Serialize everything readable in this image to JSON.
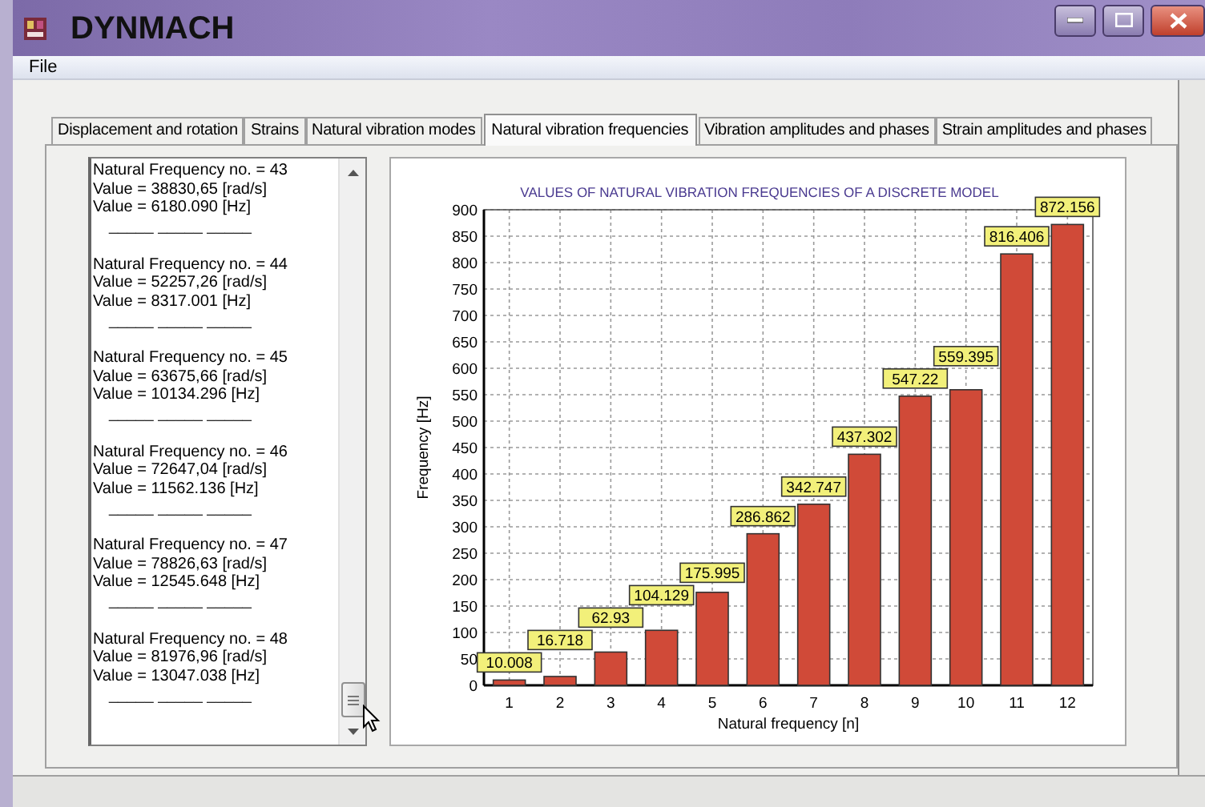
{
  "window": {
    "title": "DYNMACH"
  },
  "menu": [
    "File"
  ],
  "tabs": [
    {
      "label": "Displacement and rotation",
      "selected": false
    },
    {
      "label": "Strains",
      "selected": false
    },
    {
      "label": "Natural vibration modes",
      "selected": false
    },
    {
      "label": "Natural vibration frequencies",
      "selected": true
    },
    {
      "label": "Vibration amplitudes and phases",
      "selected": false
    },
    {
      "label": "Strain amplitudes and phases",
      "selected": false
    }
  ],
  "frequency_list": {
    "entries": [
      {
        "title": "Natural Frequency no. = 43",
        "rad": "Value = 38830,65 [rad/s]",
        "hz": "Value = 6180.090 [Hz]",
        "separator": "_____  _____  _____"
      },
      {
        "title": "Natural Frequency no. = 44",
        "rad": "Value = 52257,26 [rad/s]",
        "hz": "Value = 8317.001 [Hz]",
        "separator": "_____  _____  _____"
      },
      {
        "title": "Natural Frequency no. = 45",
        "rad": "Value = 63675,66 [rad/s]",
        "hz": "Value = 10134.296 [Hz]",
        "separator": "_____  _____  _____"
      },
      {
        "title": "Natural Frequency no. = 46",
        "rad": "Value = 72647,04 [rad/s]",
        "hz": "Value = 11562.136 [Hz]",
        "separator": "_____  _____  _____"
      },
      {
        "title": "Natural Frequency no. = 47",
        "rad": "Value = 78826,63 [rad/s]",
        "hz": "Value = 12545.648 [Hz]",
        "separator": "_____  _____  _____"
      },
      {
        "title": "Natural Frequency no. = 48",
        "rad": "Value = 81976,96 [rad/s]",
        "hz": "Value = 13047.038 [Hz]",
        "separator": "_____  _____  _____"
      }
    ]
  },
  "chart": {
    "chart_data": {
      "type": "bar",
      "title": "VALUES OF NATURAL VIBRATION FREQUENCIES OF A DISCRETE MODEL",
      "xlabel": "Natural frequency [n]",
      "ylabel": "Frequency  [Hz]",
      "categories": [
        "1",
        "2",
        "3",
        "4",
        "5",
        "6",
        "7",
        "8",
        "9",
        "10",
        "11",
        "12"
      ],
      "series": [
        {
          "color": "#d04a38",
          "values": [
            10.008,
            16.718,
            62.93,
            104.129,
            175.995,
            286.862,
            342.747,
            437.302,
            547.22,
            559.395,
            816.406,
            872.156
          ]
        }
      ],
      "ylim": [
        0,
        900
      ],
      "grid": true,
      "yticks": [
        0,
        50,
        100,
        150,
        200,
        250,
        300,
        350,
        400,
        450,
        500,
        550,
        600,
        650,
        700,
        750,
        800,
        850,
        900
      ],
      "value_labels": [
        "10.008",
        "16.718",
        "62.93",
        "104.129",
        "175.995",
        "286.862",
        "342.747",
        "437.302",
        "547.22",
        "559.395",
        "816.406",
        "872.156"
      ]
    }
  }
}
